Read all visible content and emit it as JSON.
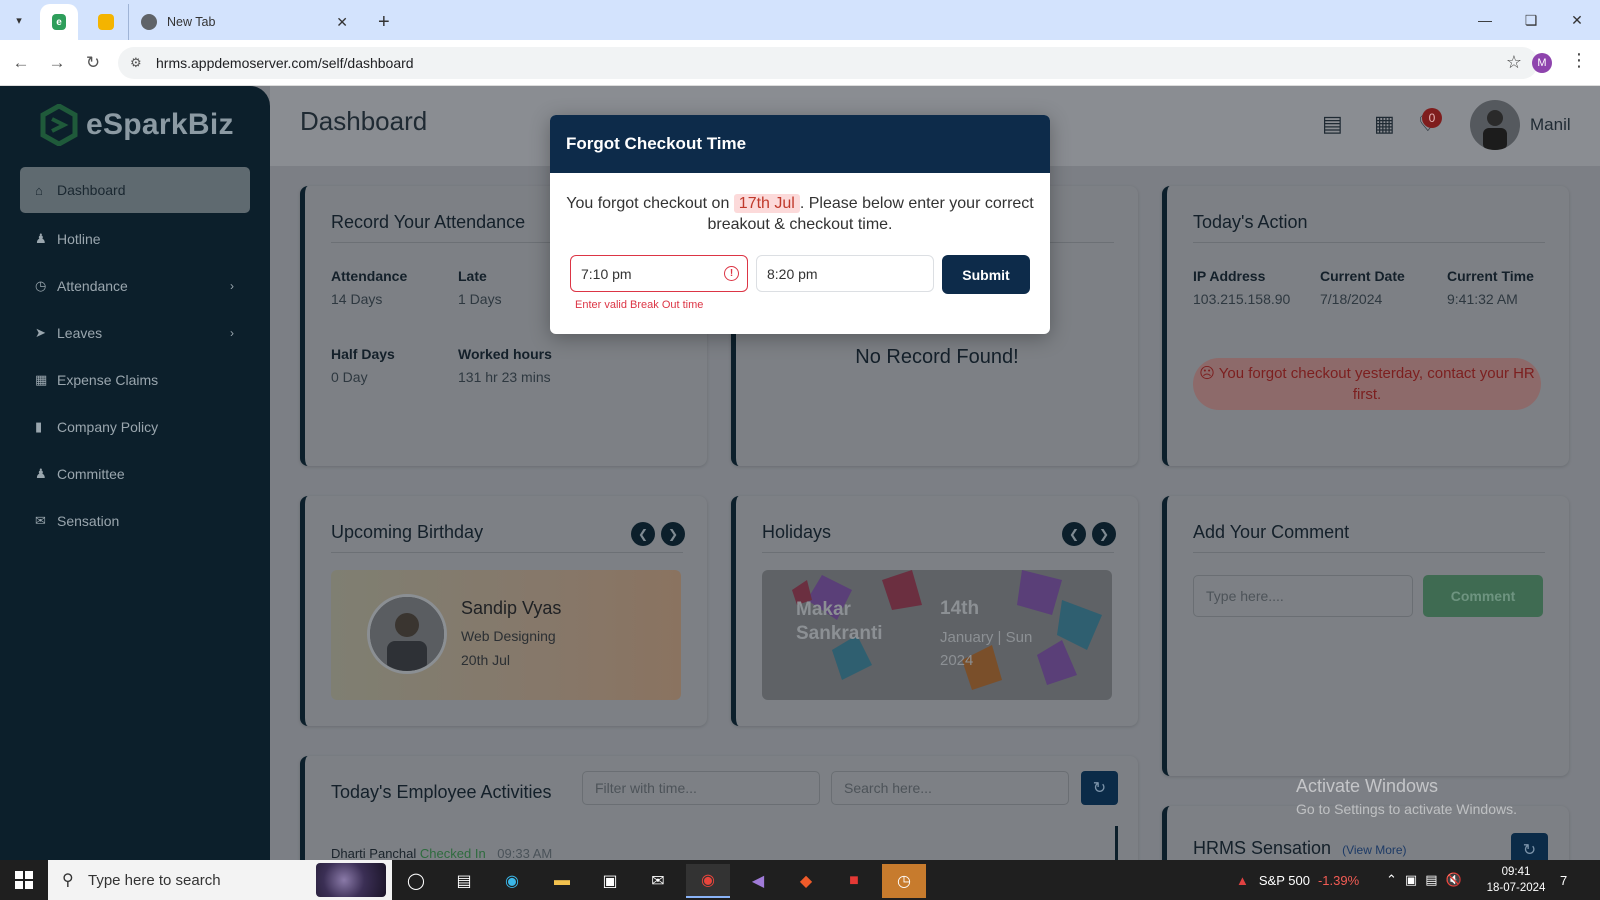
{
  "browser": {
    "tabs": [
      {
        "label": ""
      },
      {
        "label": ""
      },
      {
        "label": "New Tab"
      }
    ],
    "url": "hrms.appdemoserver.com/self/dashboard",
    "profile_initial": "M"
  },
  "sidebar": {
    "logo": "eSparkBiz",
    "items": [
      {
        "label": "Dashboard",
        "icon": "home-icon"
      },
      {
        "label": "Hotline",
        "icon": "person-icon"
      },
      {
        "label": "Attendance",
        "icon": "clock-icon"
      },
      {
        "label": "Leaves",
        "icon": "rocket-icon"
      },
      {
        "label": "Expense Claims",
        "icon": "calculator-icon"
      },
      {
        "label": "Company Policy",
        "icon": "file-icon"
      },
      {
        "label": "Committee",
        "icon": "users-icon"
      },
      {
        "label": "Sensation",
        "icon": "chat-icon"
      }
    ]
  },
  "header": {
    "title": "Dashboard",
    "notification_count": "0",
    "user_name": "Manil"
  },
  "attendance": {
    "title": "Record Your Attendance",
    "stats": [
      {
        "label": "Attendance",
        "value": "14 Days"
      },
      {
        "label": "Late",
        "value": "1 Days"
      },
      {
        "label": "Half Days",
        "value": "0 Day"
      },
      {
        "label": "Worked hours",
        "value": "131 hr 23 mins"
      }
    ]
  },
  "middle_card": {
    "empty_text": "No Record Found!"
  },
  "today_action": {
    "title": "Today's Action",
    "ip_label": "IP Address",
    "ip_value": "103.215.158.90",
    "date_label": "Current Date",
    "date_value": "7/18/2024",
    "time_label": "Current Time",
    "time_value": "9:41:32 AM",
    "alert": "You forgot checkout yesterday, contact your HR first."
  },
  "birthday": {
    "title": "Upcoming Birthday",
    "name": "Sandip Vyas",
    "department": "Web Designing",
    "date": "20th Jul"
  },
  "holidays": {
    "title": "Holidays",
    "name_line1": "Makar",
    "name_line2": "Sankranti",
    "day": "14th",
    "date_line1": "January | Sun",
    "date_line2": "2024"
  },
  "comment": {
    "title": "Add Your Comment",
    "placeholder": "Type here....",
    "button": "Comment"
  },
  "activities": {
    "title": "Today's Employee Activities",
    "filter_placeholder": "Filter with time...",
    "search_placeholder": "Search here...",
    "row_name": "Dharti Panchal",
    "row_status": "Checked In",
    "row_time": "09:33 AM"
  },
  "sensation": {
    "title": "HRMS Sensation",
    "view_more": "(View More)"
  },
  "watermark": {
    "line1": "Activate Windows",
    "line2": "Go to Settings to activate Windows."
  },
  "modal": {
    "title": "Forgot Checkout Time",
    "msg_before": "You forgot checkout on ",
    "msg_date": "17th Jul",
    "msg_after": ". Please below enter your correct breakout & checkout time.",
    "breakout_value": "7:10 pm",
    "checkout_value": "8:20 pm",
    "error": "Enter valid Break Out time",
    "submit": "Submit"
  },
  "taskbar": {
    "search_placeholder": "Type here to search",
    "stock_name": "S&P 500",
    "stock_change": "-1.39%",
    "time": "09:41",
    "date": "18-07-2024",
    "notif_count": "7"
  },
  "colors": {
    "sidebar": "#0c1f2b",
    "modal_header": "#0d2b4a",
    "error": "#dc3545",
    "comment_button": "#3f6b52"
  }
}
